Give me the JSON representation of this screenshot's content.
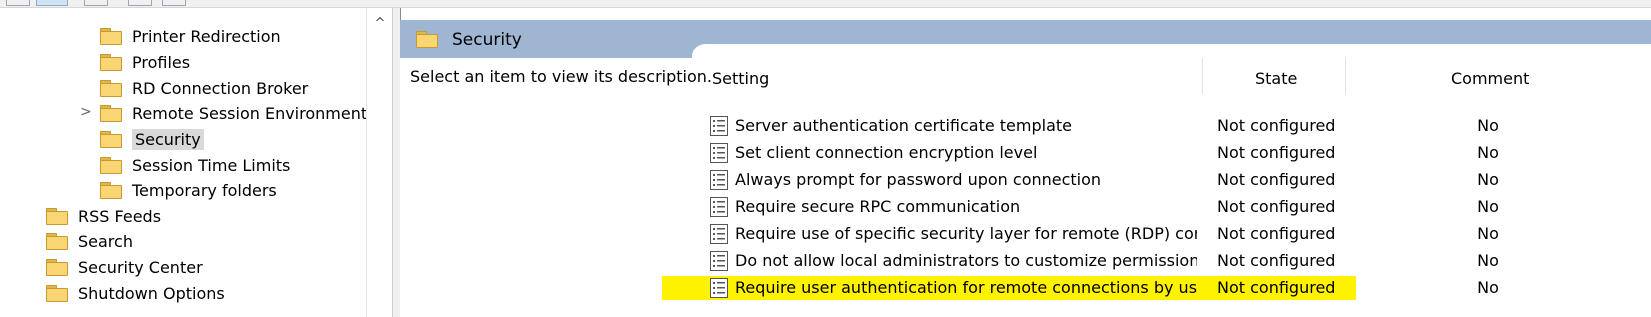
{
  "tree": {
    "items": [
      {
        "label": "Printer Redirection"
      },
      {
        "label": "Profiles"
      },
      {
        "label": "RD Connection Broker"
      },
      {
        "label": "Remote Session Environment"
      },
      {
        "label": "Security"
      },
      {
        "label": "Session Time Limits"
      },
      {
        "label": "Temporary folders"
      },
      {
        "label": "RSS Feeds"
      },
      {
        "label": "Search"
      },
      {
        "label": "Security Center"
      },
      {
        "label": "Shutdown Options"
      }
    ],
    "expander_glyph": ">",
    "scroll_up_glyph": "^"
  },
  "pane": {
    "title": "Security",
    "description": "Select an item to view its description.",
    "columns": {
      "setting": "Setting",
      "state": "State",
      "comment": "Comment"
    },
    "rows": [
      {
        "setting": "Server authentication certificate template",
        "state": "Not configured",
        "comment": "No"
      },
      {
        "setting": "Set client connection encryption level",
        "state": "Not configured",
        "comment": "No"
      },
      {
        "setting": "Always prompt for password upon connection",
        "state": "Not configured",
        "comment": "No"
      },
      {
        "setting": "Require secure RPC communication",
        "state": "Not configured",
        "comment": "No"
      },
      {
        "setting": "Require use of specific security layer for remote (RDP) connec...",
        "state": "Not configured",
        "comment": "No"
      },
      {
        "setting": "Do not allow local administrators to customize permissions",
        "state": "Not configured",
        "comment": "No"
      },
      {
        "setting": "Require user authentication for remote connections by using...",
        "state": "Not configured",
        "comment": "No"
      }
    ]
  },
  "colors": {
    "header": "#9eb6d1",
    "highlight": "#fff200",
    "selected": "#d9d9d9"
  }
}
